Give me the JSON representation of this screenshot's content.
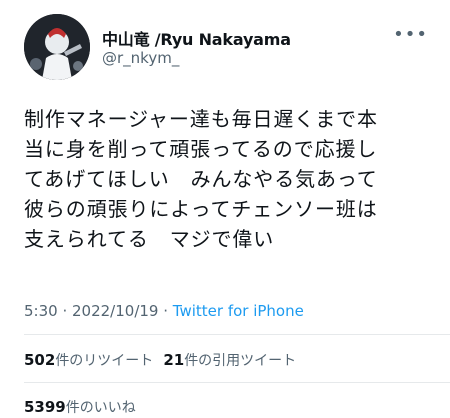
{
  "user": {
    "display_name": "中山竜 /Ryu Nakayama",
    "handle": "@r_nkym_",
    "avatar_icon": "character-avatar-icon"
  },
  "tweet": {
    "text": "制作マネージャー達も毎日遅くまで本\n当に身を削って頑張ってるので応援し\nてあげてほしい　みんなやる気あって\n彼らの頑張りによってチェンソー班は\n支えられてる　マジで偉い"
  },
  "meta": {
    "time": "5:30",
    "separator1": " · ",
    "date": "2022/10/19",
    "separator2": " · ",
    "source": "Twitter for iPhone"
  },
  "stats": {
    "retweets_count": "502",
    "retweets_label": "件のリツイート",
    "quotes_count": "21",
    "quotes_label": "件の引用ツイート",
    "likes_count": "5399",
    "likes_label": "件のいいね"
  },
  "colors": {
    "text": "#0f1419",
    "secondary": "#536471",
    "link": "#1d9bf0",
    "divider": "#e6e9eb"
  }
}
